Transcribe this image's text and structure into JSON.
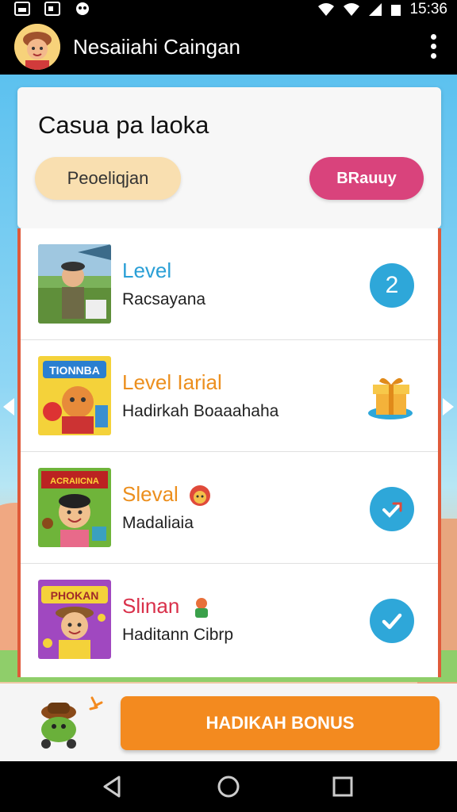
{
  "status_bar": {
    "time": "15:36"
  },
  "app_bar": {
    "title": "Nesaiiahi Caingan"
  },
  "card": {
    "title": "Casua pa laoka",
    "left_pill": "Peoeliqjan",
    "right_pill": "BRauuy",
    "right_pill_color": "#d9437c"
  },
  "list": {
    "items": [
      {
        "title": "Level",
        "title_color": "#2a9fd6",
        "subtitle": "Racsayana",
        "status": "2",
        "status_icon": "number-badge"
      },
      {
        "title": "Level Iarial",
        "title_color": "#ec8f1e",
        "subtitle": "Hadirkah Boaaahaha",
        "status_icon": "gift-box-icon"
      },
      {
        "title": "Sleval",
        "title_color": "#ec8f1e",
        "subtitle": "Madaliaia",
        "status_icon": "arrow-check-icon"
      },
      {
        "title": "Slinan",
        "title_color": "#d9304a",
        "subtitle": "Haditann Cibrp",
        "status_icon": "check-icon"
      }
    ],
    "thumbs": [
      {
        "label": ""
      },
      {
        "label": "TIONNBA"
      },
      {
        "label": "ACRAIICNA"
      },
      {
        "label": "PHOKAN"
      }
    ]
  },
  "bottom": {
    "bonus_label": "HADIKAH BONUS",
    "bonus_color": "#f38a1f"
  },
  "colors": {
    "accent": "#2ea7d9",
    "list_border": "#e05a3a"
  }
}
